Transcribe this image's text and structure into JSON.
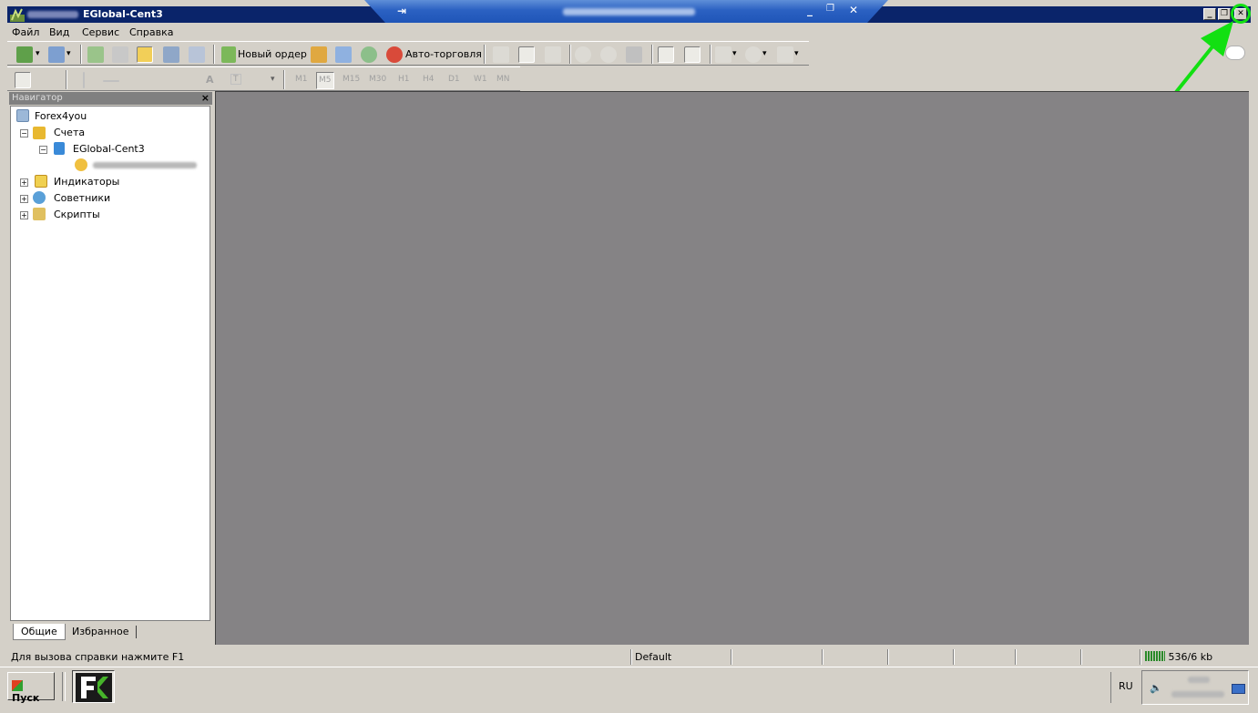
{
  "window": {
    "title": "EGlobal-Cent3",
    "minimize_label": "_",
    "restore_label": "❐",
    "close_label": "✕"
  },
  "teamviewer": {
    "pin_label": "⇥",
    "min_label": "_",
    "restore_label": "❐",
    "close_label": "✕"
  },
  "menu": {
    "items": [
      "Файл",
      "Вид",
      "Сервис",
      "Справка"
    ]
  },
  "toolbar": {
    "new_order_label": "Новый ордер",
    "autotrading_label": "Авто-торговля",
    "text_tool_label": "A",
    "text_label_tool": "T"
  },
  "timeframes": [
    "M1",
    "M5",
    "M15",
    "M30",
    "H1",
    "H4",
    "D1",
    "W1",
    "MN"
  ],
  "navigator": {
    "title": "Навигатор",
    "close_label": "×",
    "tree": {
      "root": "Forex4you",
      "accounts": "Счета",
      "server": "EGlobal-Cent3",
      "indicators": "Индикаторы",
      "experts": "Советники",
      "scripts": "Скрипты"
    },
    "tabs": [
      "Общие",
      "Избранное"
    ]
  },
  "status": {
    "help_text": "Для вызова справки нажмите F1",
    "profile": "Default",
    "traffic": "536/6 kb"
  },
  "taskbar": {
    "start_label": "Пуск",
    "language": "RU"
  },
  "colors": {
    "titlebar": "#0a246a",
    "workspace": "#858385",
    "highlight": "#12e012"
  }
}
